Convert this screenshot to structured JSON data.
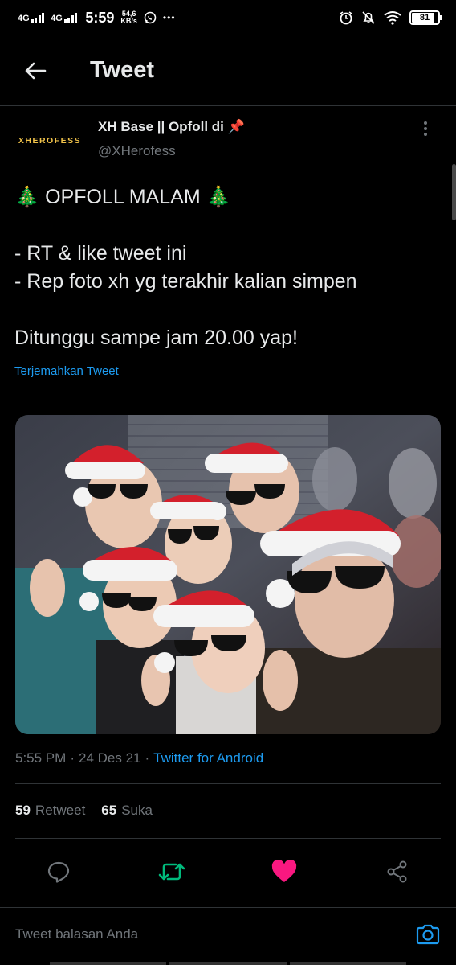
{
  "status_bar": {
    "signal_1": "4G",
    "signal_2": "4G",
    "time": "5:59",
    "speed_value": "54,6",
    "speed_unit": "KB/s",
    "dots": "•••",
    "battery": "81"
  },
  "header": {
    "title": "Tweet",
    "back_icon": "arrow-left-icon"
  },
  "tweet": {
    "avatar_text": "XHEROFESS",
    "author_name": "XH Base || Opfoll di 📌",
    "author_handle": "@XHerofess",
    "lines": [
      "🎄 OPFOLL MALAM 🎄",
      "",
      "- RT & like tweet ini",
      "- Rep foto xh yg terakhir kalian simpen",
      "",
      "Ditunggu sampe jam 20.00 yap!"
    ],
    "translate_link": "Terjemahkan Tweet",
    "time": "5:55 PM",
    "separator": "·",
    "date": "24 Des 21",
    "source": "Twitter for Android"
  },
  "stats": {
    "retweet_count": "59",
    "retweet_label": "Retweet",
    "like_count": "65",
    "like_label": "Suka"
  },
  "actions": {
    "reply_icon": "reply-icon",
    "retweet_icon": "retweet-icon",
    "like_icon": "heart-icon",
    "share_icon": "share-icon",
    "retweet_color": "#00ba7c",
    "like_color": "#f91880"
  },
  "reply_bar": {
    "placeholder": "Tweet balasan Anda",
    "camera_icon": "camera-icon"
  },
  "colors": {
    "background": "#000000",
    "link": "#1d9bf0",
    "muted": "#71767b"
  }
}
